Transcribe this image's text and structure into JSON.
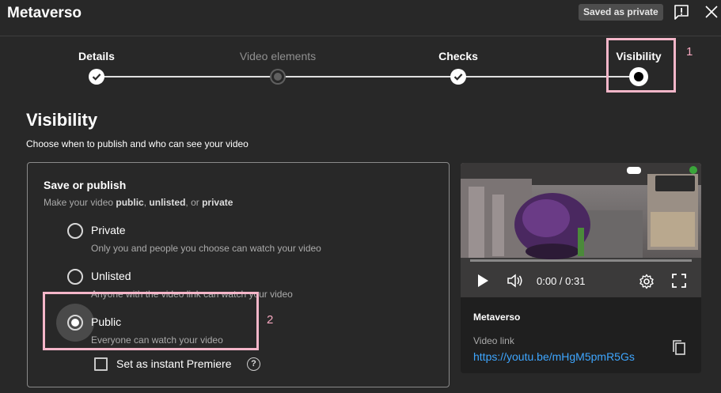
{
  "header": {
    "title": "Metaverso",
    "saved_badge": "Saved as private"
  },
  "stepper": {
    "steps": [
      {
        "label": "Details",
        "state": "done"
      },
      {
        "label": "Video elements",
        "state": "inactive"
      },
      {
        "label": "Checks",
        "state": "done"
      },
      {
        "label": "Visibility",
        "state": "current"
      }
    ]
  },
  "annotations": {
    "marker_1": "1",
    "marker_2": "2",
    "color": "#f4b6c9"
  },
  "visibility": {
    "heading": "Visibility",
    "subheading": "Choose when to publish and who can see your video"
  },
  "save_publish": {
    "title": "Save or publish",
    "desc_prefix": "Make your video ",
    "desc_public": "public",
    "desc_sep1": ", ",
    "desc_unlisted": "unlisted",
    "desc_sep2": ", or ",
    "desc_private": "private",
    "options": [
      {
        "label": "Private",
        "desc": "Only you and people you choose can watch your video",
        "selected": false
      },
      {
        "label": "Unlisted",
        "desc": "Anyone with the video link can watch your video",
        "selected": false
      },
      {
        "label": "Public",
        "desc": "Everyone can watch your video",
        "selected": true
      }
    ],
    "premiere_label": "Set as instant Premiere",
    "premiere_checked": false,
    "help_glyph": "?"
  },
  "preview": {
    "time": "0:00 / 0:31",
    "progress": 0,
    "title": "Metaverso",
    "link_label": "Video link",
    "link": "https://youtu.be/mHgM5pmR5Gs"
  },
  "colors": {
    "background": "#282828",
    "link": "#3ea6ff",
    "annotation": "#f4b6c9"
  }
}
